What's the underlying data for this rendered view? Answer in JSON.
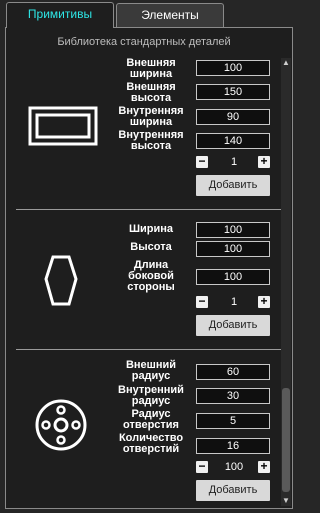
{
  "tabs": [
    {
      "label": "Примитивы",
      "active": true
    },
    {
      "label": "Элементы",
      "active": false
    }
  ],
  "library_title": "Библиотека стандартных деталей",
  "sections": [
    {
      "shape_icon": "rectangle-frame-icon",
      "params": [
        {
          "label": "Внешняя\nширина",
          "value": "100"
        },
        {
          "label": "Внешняя\nвысота",
          "value": "150"
        },
        {
          "label": "Внутренняя\nширина",
          "value": "90"
        },
        {
          "label": "Внутренняя\nвысота",
          "value": "140"
        }
      ],
      "quantity": "1",
      "add_label": "Добавить"
    },
    {
      "shape_icon": "hexagon-icon",
      "params": [
        {
          "label": "Ширина",
          "value": "100"
        },
        {
          "label": "Высота",
          "value": "100"
        },
        {
          "label": "Длина\nбоковой\nстороны",
          "value": "100"
        }
      ],
      "quantity": "1",
      "add_label": "Добавить"
    },
    {
      "shape_icon": "flange-disc-icon",
      "params": [
        {
          "label": "Внешний\nрадиус",
          "value": "60"
        },
        {
          "label": "Внутренний\nрадиус",
          "value": "30"
        },
        {
          "label": "Радиус\nотверстия",
          "value": "5"
        },
        {
          "label": "Количество\nотверстий",
          "value": "16"
        }
      ],
      "quantity": "100",
      "add_label": "Добавить"
    }
  ],
  "qty_minus": "−",
  "qty_plus": "+",
  "scroll_up": "▲",
  "scroll_down": "▼"
}
